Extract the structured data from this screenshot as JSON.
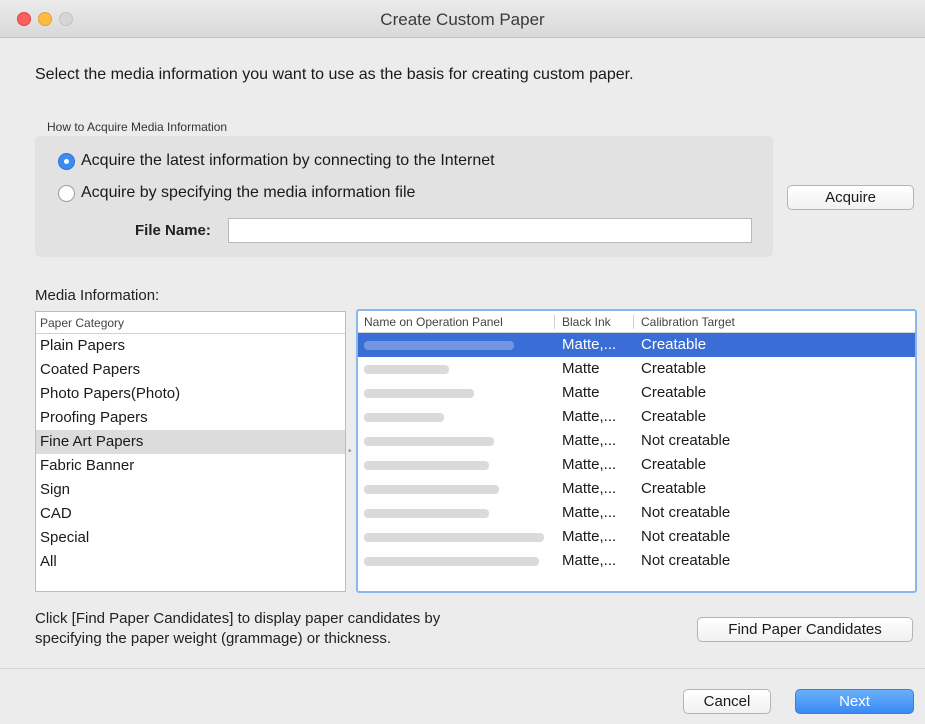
{
  "window": {
    "title": "Create Custom Paper"
  },
  "intro_text": "Select the media information you want to use as the basis for creating custom paper.",
  "acquire_group": {
    "label": "How to Acquire Media Information",
    "option_internet": "Acquire the latest information by connecting to the Internet",
    "option_file": "Acquire by specifying the media information file",
    "selected_option": "internet",
    "file_name_label": "File Name:",
    "file_name_value": "",
    "acquire_button": "Acquire"
  },
  "media_info": {
    "label": "Media Information:",
    "category_header": "Paper Category",
    "categories": [
      "Plain Papers",
      "Coated Papers",
      "Photo Papers(Photo)",
      "Proofing Papers",
      "Fine Art Papers",
      "Fabric Banner",
      "Sign",
      "CAD",
      "Special",
      "All"
    ],
    "selected_category": "Fine Art Papers",
    "table_headers": {
      "name": "Name on Operation Panel",
      "black_ink": "Black Ink",
      "calibration": "Calibration Target"
    },
    "rows": [
      {
        "black_ink": "Matte,...",
        "calibration": "Creatable",
        "selected": true
      },
      {
        "black_ink": "Matte",
        "calibration": "Creatable"
      },
      {
        "black_ink": "Matte",
        "calibration": "Creatable"
      },
      {
        "black_ink": "Matte,...",
        "calibration": "Creatable"
      },
      {
        "black_ink": "Matte,...",
        "calibration": "Not creatable"
      },
      {
        "black_ink": "Matte,...",
        "calibration": "Creatable"
      },
      {
        "black_ink": "Matte,...",
        "calibration": "Creatable"
      },
      {
        "black_ink": "Matte,...",
        "calibration": "Not creatable"
      },
      {
        "black_ink": "Matte,...",
        "calibration": "Not creatable"
      },
      {
        "black_ink": "Matte,...",
        "calibration": "Not creatable"
      }
    ]
  },
  "hint_text_line1": "Click [Find Paper Candidates] to display paper candidates by",
  "hint_text_line2": "specifying the paper weight (grammage) or thickness.",
  "buttons": {
    "find_candidates": "Find Paper Candidates",
    "cancel": "Cancel",
    "next": "Next"
  },
  "colors": {
    "selection_blue": "#3b6dd6",
    "default_button_blue": "#3b89f5",
    "focus_ring": "#8ab6ee"
  }
}
